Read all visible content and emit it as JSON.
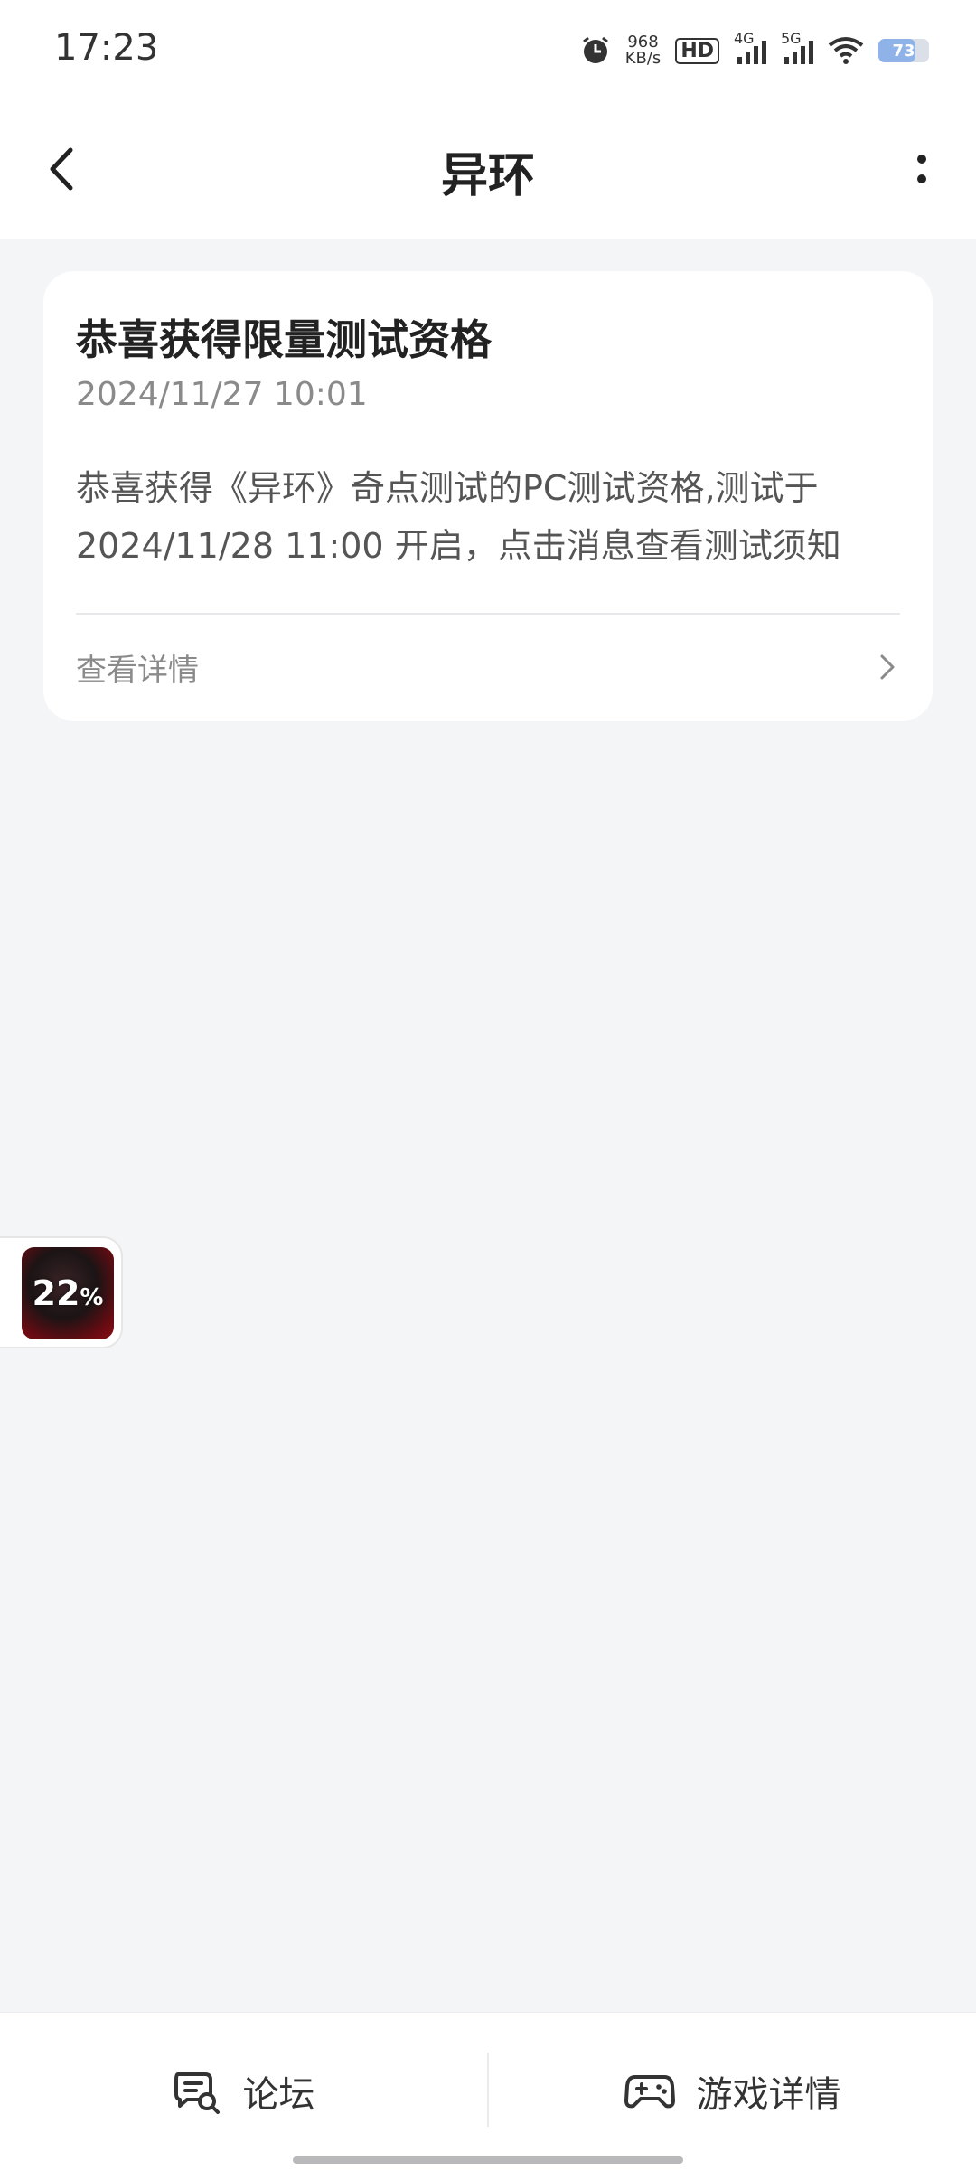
{
  "status_bar": {
    "time": "17:23",
    "net_speed_value": "968",
    "net_speed_unit": "KB/s",
    "hd_label": "HD",
    "signal1_label": "4G",
    "signal2_label": "5G",
    "battery": "73"
  },
  "app_bar": {
    "title": "异环",
    "back_icon": "chevron-left-icon",
    "more_icon": "vertical-dots-icon"
  },
  "message_card": {
    "title": "恭喜获得限量测试资格",
    "time": "2024/11/27 10:01",
    "body": "恭喜获得《异环》奇点测试的PC测试资格,测试于2024/11/28 11:00 开启，点击消息查看测试须知",
    "detail_label": "查看详情"
  },
  "floating_download": {
    "progress_value": "22",
    "progress_unit": "%"
  },
  "bottom_bar": {
    "forum_label": "论坛",
    "game_detail_label": "游戏详情"
  }
}
